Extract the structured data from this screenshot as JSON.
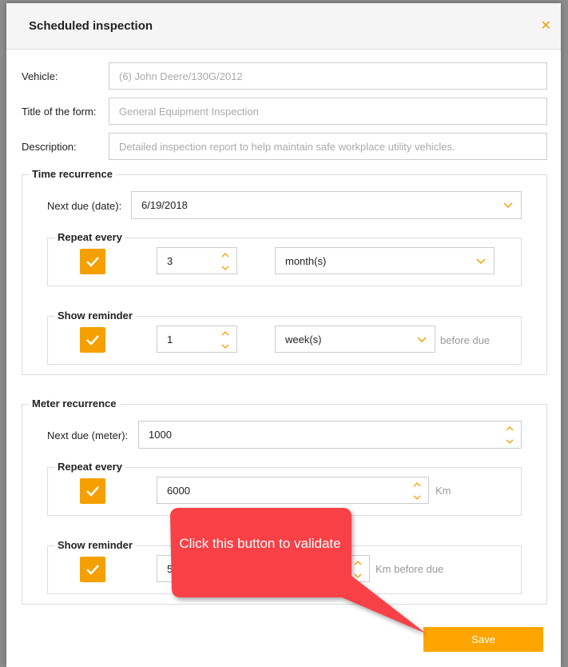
{
  "dialog": {
    "title": "Scheduled inspection",
    "close_icon": "close-icon"
  },
  "form": {
    "vehicle_label": "Vehicle:",
    "vehicle_value": "(6) John Deere/130G/2012",
    "title_label": "Title of the form:",
    "title_value": "General Equipment Inspection",
    "description_label": "Description:",
    "description_value": "Detailed inspection report to help maintain safe workplace utility vehicles."
  },
  "time_recurrence": {
    "legend": "Time recurrence",
    "next_due_label": "Next due (date):",
    "next_due_value": "6/19/2018",
    "repeat": {
      "legend": "Repeat every",
      "checked": true,
      "value": "3",
      "unit": "month(s)"
    },
    "reminder": {
      "legend": "Show reminder",
      "checked": true,
      "value": "1",
      "unit": "week(s)",
      "suffix": "before due"
    }
  },
  "meter_recurrence": {
    "legend": "Meter recurrence",
    "next_due_label": "Next due (meter):",
    "next_due_value": "1000",
    "repeat": {
      "legend": "Repeat every",
      "checked": true,
      "value": "6000",
      "suffix": "Km"
    },
    "reminder": {
      "legend": "Show reminder",
      "checked": true,
      "value": "5",
      "suffix": "Km before due"
    }
  },
  "save_label": "Save",
  "callout": {
    "text": "Click this button to validate",
    "color": "#f84147"
  },
  "colors": {
    "accent": "#ffa500"
  }
}
